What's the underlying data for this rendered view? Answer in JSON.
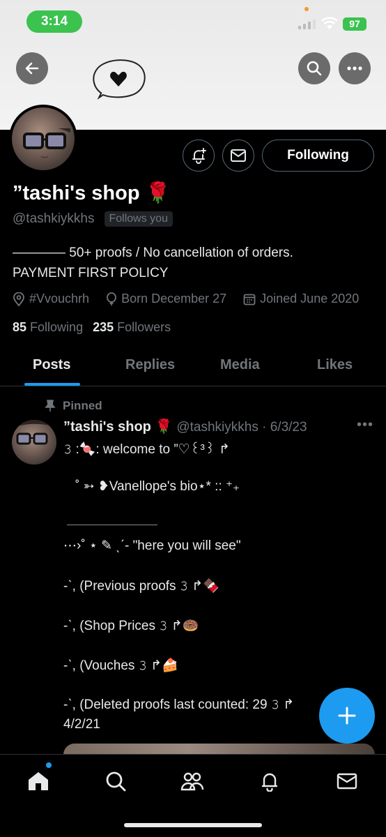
{
  "status_bar": {
    "time": "3:14",
    "battery": "97"
  },
  "profile": {
    "display_name": "”tashi's shop 🌹",
    "handle": "@tashkiykkhs",
    "follows_you": "Follows you",
    "follow_button": "Following",
    "bio_line1": "———— 50+ proofs / No cancellation of orders.",
    "bio_line2": "PAYMENT FIRST POLICY",
    "location": "#Vvouchrh",
    "birthday": "Born December 27",
    "joined": "Joined June 2020",
    "following_count": "85",
    "following_label": "Following",
    "followers_count": "235",
    "followers_label": "Followers"
  },
  "tabs": [
    {
      "label": "Posts",
      "active": true
    },
    {
      "label": "Replies",
      "active": false
    },
    {
      "label": "Media",
      "active": false
    },
    {
      "label": "Likes",
      "active": false
    }
  ],
  "post": {
    "pinned_label": "Pinned",
    "author_name": "”tashi's shop 🌹",
    "author_handle_date": "@tashkiykkhs · 6/3/23",
    "lines": [
      "𝟹 :🍬: welcome to ”♡꒰³꒱ ↱",
      "˚ ➳ ❥Vanellope's bio⋆* :: ⁺₊",
      "﹏﹏﹏﹏﹏﹏﹏﹏﹏﹏",
      "⋯›˚ ⋆ ✎ ˎˊ- \"here you will see\"",
      "-ˋ, (Previous proofs 𝟹 ↱🍫",
      "-ˋ, (Shop Prices 𝟹 ↱🍩",
      "-ˋ, (Vouches 𝟹 ↱🍰",
      "-ˋ, (Deleted proofs last counted: 29 𝟹 ↱",
      "4/2/21"
    ]
  },
  "icons": {
    "back": "back-arrow-icon",
    "search": "search-icon",
    "more": "more-icon",
    "notify": "bell-plus-icon",
    "message": "mail-icon",
    "compose": "plus-icon"
  },
  "colors": {
    "accent": "#1d9bf0",
    "status_green": "#3bc24f",
    "muted": "#71767b"
  }
}
